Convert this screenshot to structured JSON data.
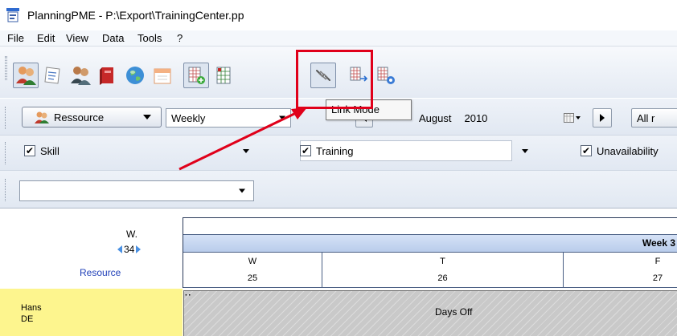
{
  "window": {
    "title": "PlanningPME - P:\\Export\\TrainingCenter.pp"
  },
  "menu": {
    "items": [
      "File",
      "Edit",
      "View",
      "Data",
      "Tools",
      "?"
    ]
  },
  "toolbar": {
    "buttons": [
      {
        "icon": "resources-icon"
      },
      {
        "icon": "tasks-icon"
      },
      {
        "icon": "customers-icon"
      },
      {
        "icon": "book-icon"
      },
      {
        "icon": "globe-icon"
      },
      {
        "icon": "calendar-icon"
      },
      {
        "icon": "add-grid-icon"
      },
      {
        "icon": "grid-icon"
      },
      {
        "icon": "link-mode-icon"
      },
      {
        "icon": "move-grid-icon"
      },
      {
        "icon": "settings-grid-icon"
      }
    ],
    "tooltip": "Link Mode",
    "highlight_color": "#e0001a"
  },
  "filters": {
    "resource_button": "Ressource",
    "view_mode": "Weekly",
    "date_month": "August",
    "date_year": "2010",
    "all_label": "All r",
    "skill": {
      "label": "Skill",
      "checked": true
    },
    "training": {
      "label": "Training",
      "checked": true
    },
    "unavailability": {
      "label": "Unavailability",
      "checked": true
    },
    "empty_combo": ""
  },
  "planning": {
    "week_abbrev": "W.",
    "week_number": "34",
    "resource_link": "Resource",
    "week_header": "Week 3",
    "days": [
      {
        "letter": "W",
        "num": "25"
      },
      {
        "letter": "T",
        "num": "26"
      },
      {
        "letter": "F",
        "num": "27"
      }
    ],
    "resource_name": "Hans",
    "resource_code": "DE",
    "days_off_label": "Days Off"
  }
}
